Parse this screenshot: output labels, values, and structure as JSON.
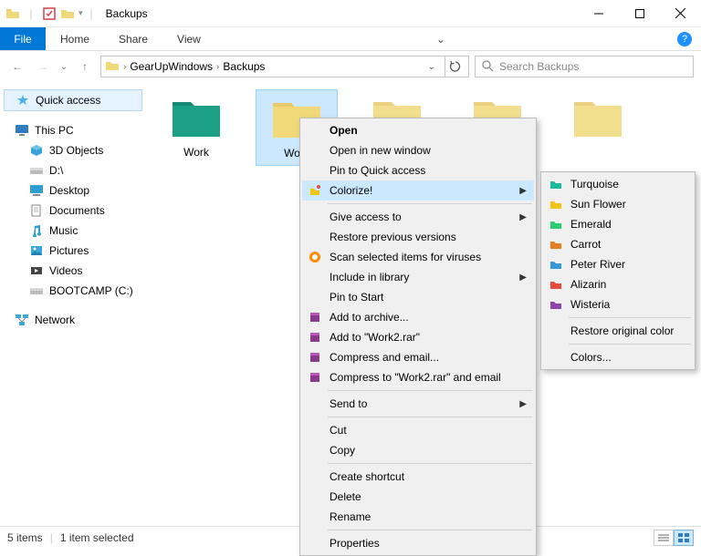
{
  "window": {
    "title": "Backups"
  },
  "ribbon": {
    "file": "File",
    "home": "Home",
    "share": "Share",
    "view": "View"
  },
  "address": {
    "crumb1": "GearUpWindows",
    "crumb2": "Backups",
    "search_placeholder": "Search Backups"
  },
  "sidebar": {
    "quick_access": "Quick access",
    "this_pc": "This PC",
    "objects3d": "3D Objects",
    "d_drive": "D:\\",
    "desktop": "Desktop",
    "documents": "Documents",
    "music": "Music",
    "pictures": "Pictures",
    "videos": "Videos",
    "bootcamp": "BOOTCAMP (C:)",
    "network": "Network"
  },
  "folders": [
    {
      "name": "Work",
      "color": "teal"
    },
    {
      "name": "Work",
      "color": "manila",
      "selected": true,
      "partial": true
    },
    {
      "name": "",
      "color": "manila"
    },
    {
      "name": "",
      "color": "manila"
    },
    {
      "name": "",
      "color": "manila"
    }
  ],
  "context_menu": {
    "open": "Open",
    "open_new_window": "Open in new window",
    "pin_quick_access": "Pin to Quick access",
    "colorize": "Colorize!",
    "give_access": "Give access to",
    "restore_prev": "Restore previous versions",
    "scan_viruses": "Scan selected items for viruses",
    "include_library": "Include in library",
    "pin_start": "Pin to Start",
    "add_archive": "Add to archive...",
    "add_rar": "Add to \"Work2.rar\"",
    "compress_email": "Compress and email...",
    "compress_rar_email": "Compress to \"Work2.rar\" and email",
    "send_to": "Send to",
    "cut": "Cut",
    "copy": "Copy",
    "create_shortcut": "Create shortcut",
    "delete": "Delete",
    "rename": "Rename",
    "properties": "Properties"
  },
  "color_submenu": {
    "turquoise": "Turquoise",
    "sunflower": "Sun Flower",
    "emerald": "Emerald",
    "carrot": "Carrot",
    "peter_river": "Peter River",
    "alizarin": "Alizarin",
    "wisteria": "Wisteria",
    "restore": "Restore original color",
    "colors": "Colors..."
  },
  "status": {
    "items": "5 items",
    "selected": "1 item selected"
  },
  "colors": {
    "turquoise": "#1abc9c",
    "sunflower": "#f1c40f",
    "emerald": "#2ecc71",
    "carrot": "#e67e22",
    "peter_river": "#3498db",
    "alizarin": "#e74c3c",
    "wisteria": "#8e44ad"
  }
}
